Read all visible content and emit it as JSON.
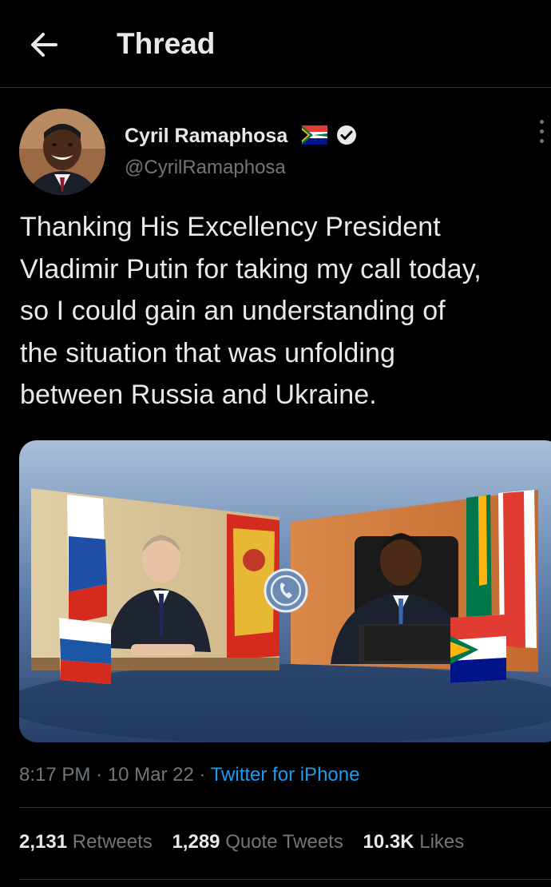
{
  "header": {
    "title": "Thread",
    "back_icon": "arrow-left-icon"
  },
  "author": {
    "name": "Cyril Ramaphosa",
    "handle": "@CyrilRamaphosa",
    "flag_icon": "south-africa-flag-icon",
    "verified_icon": "verified-badge-icon"
  },
  "tweet": {
    "text": "Thanking His Excellency President\nVladimir Putin for taking my call today,\nso I could gain an understanding of\nthe situation that was unfolding\nbetween Russia and Ukraine."
  },
  "meta": {
    "time": "8:17 PM",
    "date": "10 Mar 22",
    "source": "Twitter for iPhone",
    "separator": "·"
  },
  "stats": {
    "retweets_count": "2,131",
    "retweets_label": "Retweets",
    "quotes_count": "1,289",
    "quotes_label": "Quote Tweets",
    "likes_count": "10.3K",
    "likes_label": "Likes"
  },
  "colors": {
    "background": "#000000",
    "text": "#e7e9ea",
    "muted": "#71767b",
    "link": "#1d9bf0",
    "divider": "#2f3336"
  }
}
